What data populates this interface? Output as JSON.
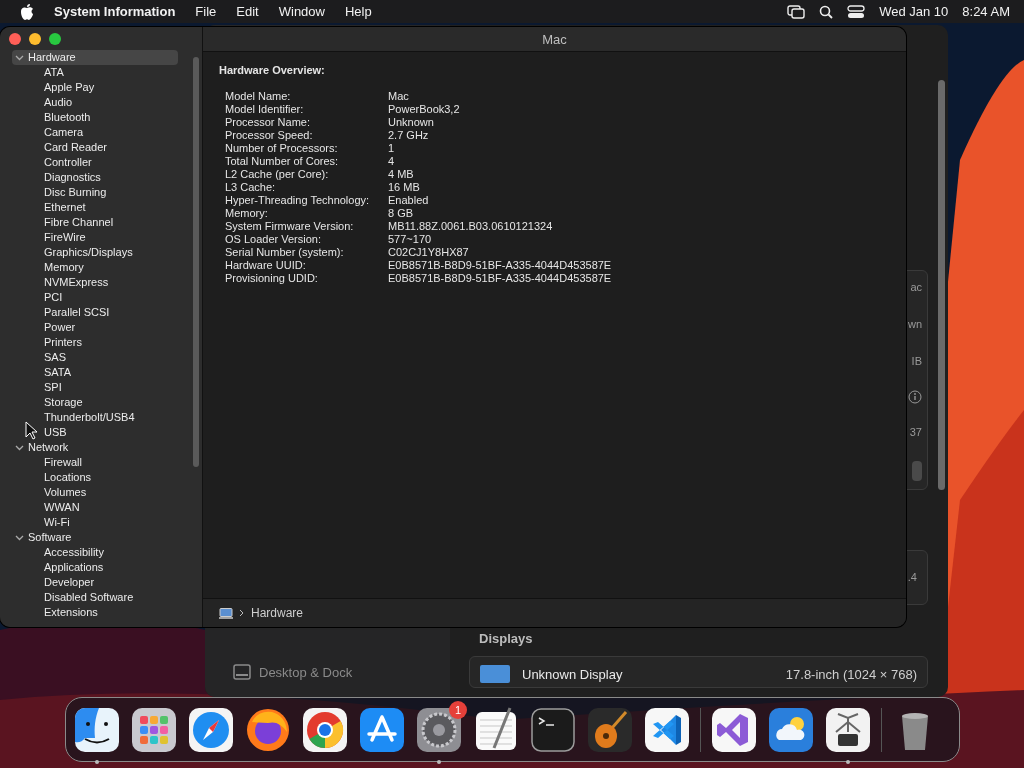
{
  "menu_bar": {
    "app_name": "System Information",
    "menus": [
      "File",
      "Edit",
      "Window",
      "Help"
    ],
    "date": "Wed Jan 10",
    "time": "8:24 AM"
  },
  "window": {
    "title": "Mac"
  },
  "sidebar": {
    "items": [
      {
        "label": "Hardware",
        "expanded": true,
        "selected": true,
        "children": [
          {
            "label": "ATA",
            "selected": false
          },
          {
            "label": "Apple Pay",
            "selected": false
          },
          {
            "label": "Audio",
            "selected": false
          },
          {
            "label": "Bluetooth",
            "selected": false
          },
          {
            "label": "Camera",
            "selected": false
          },
          {
            "label": "Card Reader",
            "selected": false
          },
          {
            "label": "Controller",
            "selected": false
          },
          {
            "label": "Diagnostics",
            "selected": false
          },
          {
            "label": "Disc Burning",
            "selected": false
          },
          {
            "label": "Ethernet",
            "selected": false
          },
          {
            "label": "Fibre Channel",
            "selected": false
          },
          {
            "label": "FireWire",
            "selected": false
          },
          {
            "label": "Graphics/Displays",
            "selected": false
          },
          {
            "label": "Memory",
            "selected": false
          },
          {
            "label": "NVMExpress",
            "selected": false
          },
          {
            "label": "PCI",
            "selected": false
          },
          {
            "label": "Parallel SCSI",
            "selected": false
          },
          {
            "label": "Power",
            "selected": false
          },
          {
            "label": "Printers",
            "selected": false
          },
          {
            "label": "SAS",
            "selected": false
          },
          {
            "label": "SATA",
            "selected": false
          },
          {
            "label": "SPI",
            "selected": false
          },
          {
            "label": "Storage",
            "selected": false
          },
          {
            "label": "Thunderbolt/USB4",
            "selected": false
          },
          {
            "label": "USB",
            "selected": false
          }
        ]
      },
      {
        "label": "Network",
        "expanded": true,
        "selected": false,
        "children": [
          {
            "label": "Firewall",
            "selected": false
          },
          {
            "label": "Locations",
            "selected": false
          },
          {
            "label": "Volumes",
            "selected": false
          },
          {
            "label": "WWAN",
            "selected": false
          },
          {
            "label": "Wi-Fi",
            "selected": false
          }
        ]
      },
      {
        "label": "Software",
        "expanded": true,
        "selected": false,
        "children": [
          {
            "label": "Accessibility",
            "selected": false
          },
          {
            "label": "Applications",
            "selected": false
          },
          {
            "label": "Developer",
            "selected": false
          },
          {
            "label": "Disabled Software",
            "selected": false
          },
          {
            "label": "Extensions",
            "selected": false
          }
        ]
      }
    ]
  },
  "overview": {
    "heading": "Hardware Overview:",
    "rows": [
      {
        "label": "Model Name:",
        "value": "Mac"
      },
      {
        "label": "Model Identifier:",
        "value": "PowerBook3,2"
      },
      {
        "label": "Processor Name:",
        "value": "Unknown"
      },
      {
        "label": "Processor Speed:",
        "value": "2.7 GHz"
      },
      {
        "label": "Number of Processors:",
        "value": "1"
      },
      {
        "label": "Total Number of Cores:",
        "value": "4"
      },
      {
        "label": "L2 Cache (per Core):",
        "value": "4 MB"
      },
      {
        "label": "L3 Cache:",
        "value": "16 MB"
      },
      {
        "label": "Hyper-Threading Technology:",
        "value": "Enabled"
      },
      {
        "label": "Memory:",
        "value": "8 GB"
      },
      {
        "label": "System Firmware Version:",
        "value": "MB11.88Z.0061.B03.0610121324"
      },
      {
        "label": "OS Loader Version:",
        "value": "577~170"
      },
      {
        "label": "Serial Number (system):",
        "value": "C02CJ1Y8HX87"
      },
      {
        "label": "Hardware UUID:",
        "value": "E0B8571B-B8D9-51BF-A335-4044D453587E"
      },
      {
        "label": "Provisioning UDID:",
        "value": "E0B8571B-B8D9-51BF-A335-4044D453587E"
      }
    ]
  },
  "path_bar": {
    "path": "Hardware"
  },
  "settings_window": {
    "sidebar_items": [
      "Desktop & Dock"
    ],
    "card_fragments": [
      "ac",
      "wn",
      "IB",
      "37"
    ],
    "card_2_fragment": ".4",
    "section": "Displays",
    "display": {
      "name": "Unknown Display",
      "size": "17.8-inch (1024 × 768)"
    }
  },
  "dock": {
    "items": [
      {
        "kind": "finder",
        "running": true
      },
      {
        "kind": "launchpad",
        "running": false
      },
      {
        "kind": "safari",
        "running": false
      },
      {
        "kind": "firefox",
        "running": false
      },
      {
        "kind": "chrome",
        "running": false
      },
      {
        "kind": "appstore",
        "running": false
      },
      {
        "kind": "settings",
        "running": true,
        "badge": "1"
      },
      {
        "kind": "textedit",
        "running": false
      },
      {
        "kind": "terminal",
        "running": false
      },
      {
        "kind": "garageband",
        "running": false
      },
      {
        "kind": "vscode",
        "running": false
      },
      {
        "kind": "divider"
      },
      {
        "kind": "visualstudio",
        "running": false
      },
      {
        "kind": "weather",
        "running": false
      },
      {
        "kind": "sysinfo",
        "running": true
      },
      {
        "kind": "divider"
      },
      {
        "kind": "trash",
        "running": false
      }
    ]
  }
}
